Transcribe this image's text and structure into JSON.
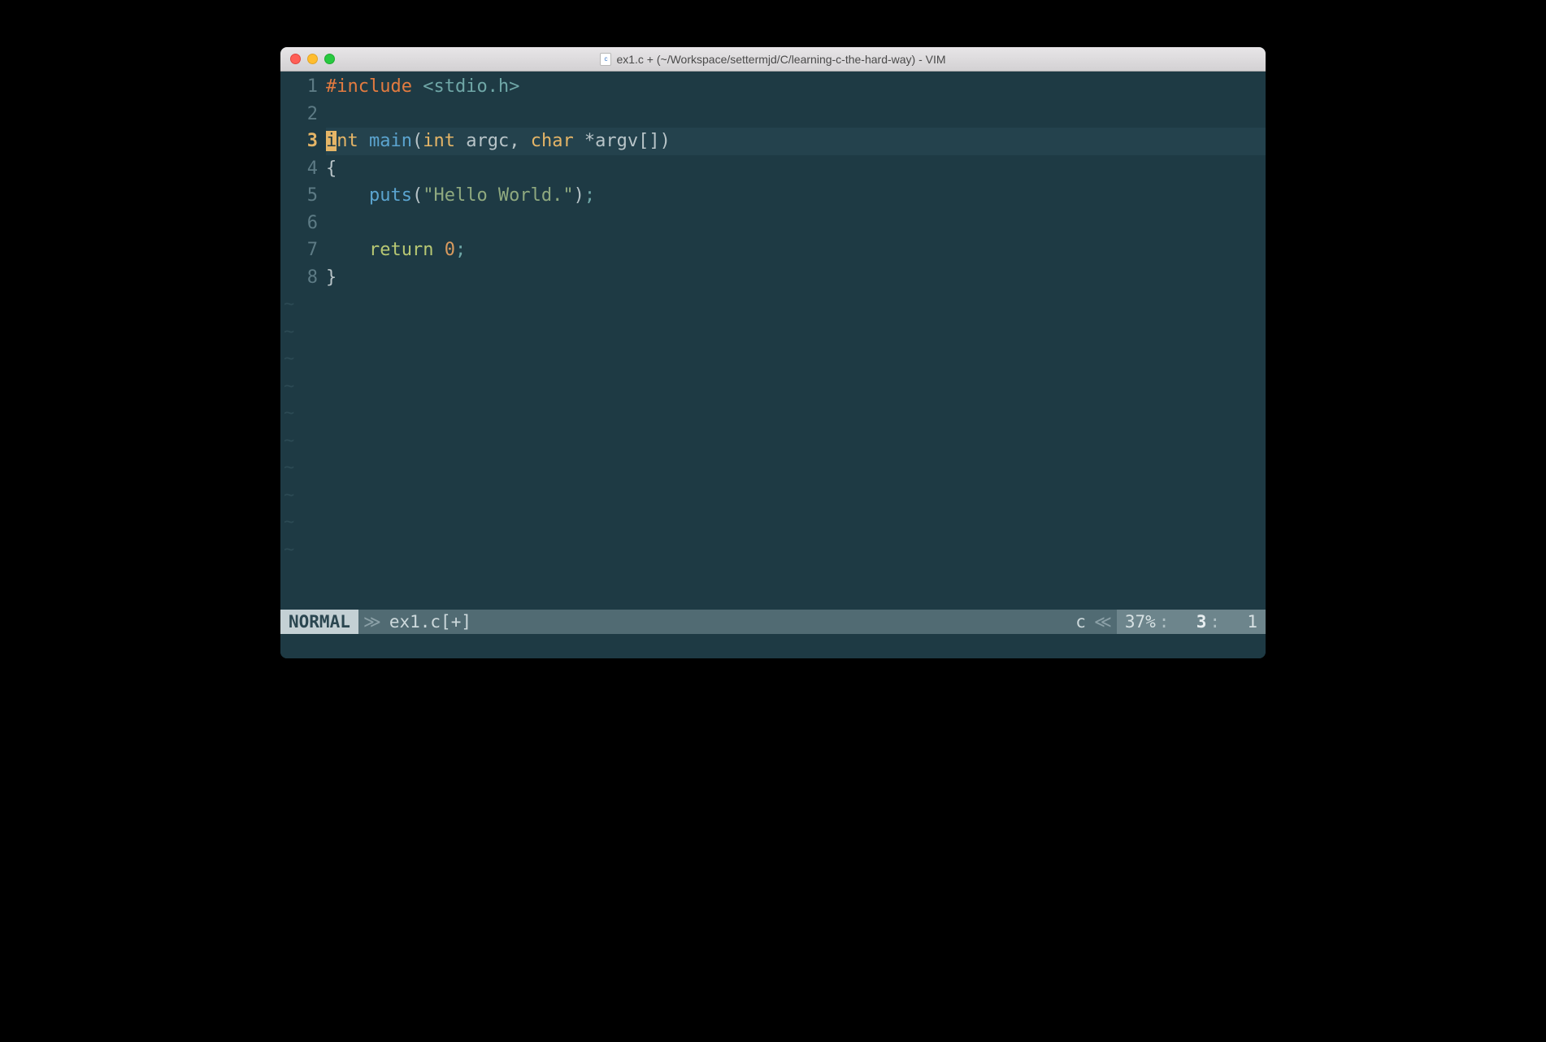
{
  "window": {
    "title": "ex1.c + (~/Workspace/settermjd/C/learning-c-the-hard-way) - VIM",
    "doc_icon_letter": "c"
  },
  "editor": {
    "line_numbers": [
      "1",
      "2",
      "3",
      "4",
      "5",
      "6",
      "7",
      "8"
    ],
    "current_line_index": 2,
    "tilde_count": 10,
    "code": {
      "l1_include": "#include",
      "l1_header": " <stdio.h>",
      "l3_cursor": "i",
      "l3_after_cursor": "nt",
      "l3_main": "main",
      "l3_lp": "(",
      "l3_int": "int",
      "l3_argc": " argc, ",
      "l3_char": "char",
      "l3_argv": " *argv[]",
      "l3_rp": ")",
      "l4_brace": "{",
      "l5_indent": "    ",
      "l5_puts": "puts",
      "l5_lp": "(",
      "l5_str": "\"Hello World.\"",
      "l5_rp": ")",
      "l5_semi": ";",
      "l7_indent": "    ",
      "l7_return": "return",
      "l7_sp": " ",
      "l7_zero": "0",
      "l7_semi": ";",
      "l8_brace": "}"
    }
  },
  "statusbar": {
    "mode": "NORMAL",
    "sep_right": "≫",
    "filename": "ex1.c[+]",
    "filetype": "c",
    "sep_left": "≪",
    "percent": "37%",
    "colon": ":",
    "row": "3",
    "col": "1"
  }
}
